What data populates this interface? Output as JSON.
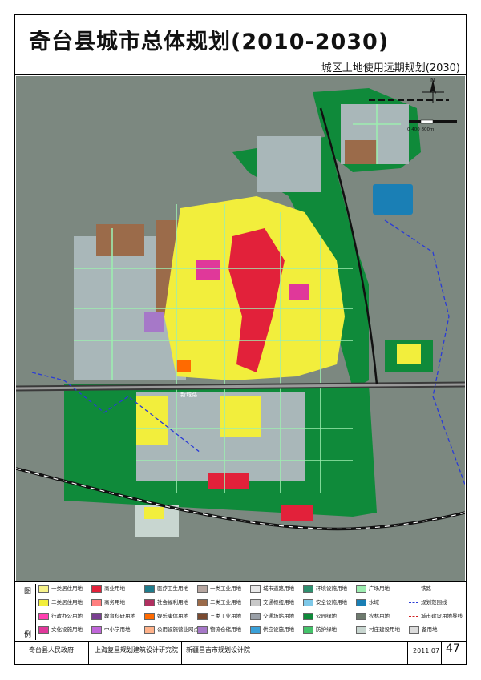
{
  "header": {
    "title": "奇台县城市总体规划(2010-2030)",
    "subtitle": "城区土地使用远期规划(2030)"
  },
  "map": {
    "north_label": "N",
    "scale_label": "0  400  800m",
    "road_label": "新城路",
    "colors": {
      "residential": "#f2ee3c",
      "commercial": "#e2213a",
      "public": "#e0389a",
      "industrial": "#aab4b8",
      "green": "#0f8a3a",
      "green_light": "#44c36a",
      "brown_storage": "#9b6b4a",
      "water": "#1a7fb5",
      "background": "#6e7a6e",
      "road": "#9dedb0",
      "rail": "#111111",
      "boundary": "#2a3bd6"
    }
  },
  "legend": {
    "heading_top": "图",
    "heading_bottom": "例",
    "items": [
      {
        "label": "一类居住用地",
        "color": "#f7f38a"
      },
      {
        "label": "二类居住用地",
        "color": "#f2ee3c"
      },
      {
        "label": "行政办公用地",
        "color": "#ff3fb0"
      },
      {
        "label": "文化设施用地",
        "color": "#e0389a"
      },
      {
        "label": "商业用地",
        "color": "#e2213a"
      },
      {
        "label": "商务用地",
        "color": "#ff7f7f"
      },
      {
        "label": "教育科研用地",
        "color": "#7a3f91"
      },
      {
        "label": "中小学用地",
        "color": "#c066d9"
      },
      {
        "label": "医疗卫生用地",
        "color": "#1f7c8c"
      },
      {
        "label": "社会福利用地",
        "color": "#b03060"
      },
      {
        "label": "娱乐康体用地",
        "color": "#ff6a00"
      },
      {
        "label": "公用设施营业网点用地",
        "color": "#ffb28a"
      },
      {
        "label": "一类工业用地",
        "color": "#b6a6a0"
      },
      {
        "label": "二类工业用地",
        "color": "#9b6b4a"
      },
      {
        "label": "三类工业用地",
        "color": "#7a4a30"
      },
      {
        "label": "物流仓储用地",
        "color": "#a678c8"
      },
      {
        "label": "城市道路用地",
        "color": "#e8e8e8"
      },
      {
        "label": "交通枢纽用地",
        "color": "#c8c8c8"
      },
      {
        "label": "交通场站用地",
        "color": "#9aa0a8"
      },
      {
        "label": "供应设施用地",
        "color": "#3aa0d8"
      },
      {
        "label": "环境设施用地",
        "color": "#2f8f6f"
      },
      {
        "label": "安全设施用地",
        "color": "#7ec8e8"
      },
      {
        "label": "公园绿地",
        "color": "#0f8a3a"
      },
      {
        "label": "防护绿地",
        "color": "#44c36a"
      },
      {
        "label": "广场用地",
        "color": "#9dedb0"
      },
      {
        "label": "水域",
        "color": "#1a7fb5"
      },
      {
        "label": "农林用地",
        "color": "#6e7a6e"
      },
      {
        "label": "村庄建设用地",
        "color": "#c8d6d0"
      },
      {
        "label": "铁路",
        "color": "#111111",
        "line": true
      },
      {
        "label": "规划范围线",
        "color": "#2a3bd6",
        "line": true
      },
      {
        "label": "城市建设用地界线",
        "color": "#d02020",
        "line": true
      },
      {
        "label": "备用地",
        "color": "#dcdcdc"
      }
    ]
  },
  "footer": {
    "org1": "奇台县人民政府",
    "org2": "上海复旦规划建筑设计研究院",
    "org3": "新疆昌吉市规划设计院",
    "date": "2011.07",
    "page": "47"
  }
}
